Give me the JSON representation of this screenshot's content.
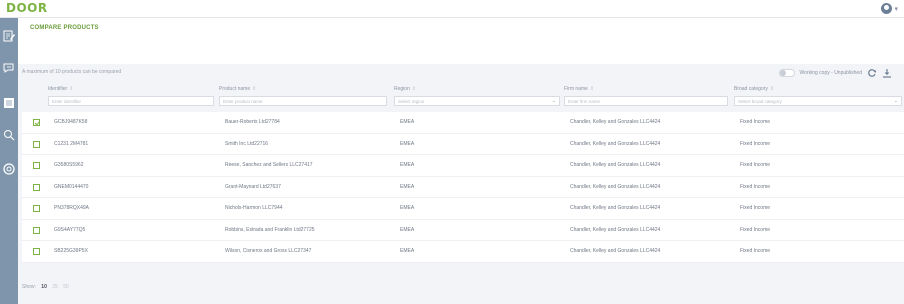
{
  "app": {
    "logo": "DOOR",
    "user_icon": "user-avatar-icon"
  },
  "sidebar": {
    "icons": [
      "edit-document-icon",
      "comment-edit-icon",
      "list-icon",
      "search-settings-icon",
      "support-lifebuoy-icon"
    ]
  },
  "page": {
    "title": "COMPARE PRODUCTS",
    "info": "A maximum of 10 products can be compared",
    "working_copy_label": "Working copy - Unpublished"
  },
  "table": {
    "columns": [
      {
        "label": "Identifier",
        "placeholder": "Enter identifier",
        "select": false
      },
      {
        "label": "Product name",
        "placeholder": "Enter product name",
        "select": false
      },
      {
        "label": "Region",
        "placeholder": "Select region",
        "select": true
      },
      {
        "label": "Firm name",
        "placeholder": "Enter firm name",
        "select": false
      },
      {
        "label": "Broad category",
        "placeholder": "Select broad category",
        "select": true
      }
    ],
    "rows": [
      {
        "checked": true,
        "cells": [
          "GCBJ9487K58",
          "Bauer-Roberts Ltd27784",
          "EMEA",
          "Chandler, Kelley and Gonzales LLC4424",
          "Fixed Income"
        ]
      },
      {
        "checked": false,
        "cells": [
          "C1231 2M4781",
          "Smith Inc Ltd22716",
          "EMEA",
          "Chandler, Kelley and Gonzales LLC4424",
          "Fixed Income"
        ]
      },
      {
        "checked": false,
        "cells": [
          "G3580S5962",
          "Reese, Sanchez and Sellers LLC27417",
          "EMEA",
          "Chandler, Kelley and Gonzales LLC4424",
          "Fixed Income"
        ]
      },
      {
        "checked": false,
        "cells": [
          "GNEM0144470",
          "Grant-Maynard Ltd27637",
          "EMEA",
          "Chandler, Kelley and Gonzales LLC4424",
          "Fixed Income"
        ]
      },
      {
        "checked": false,
        "cells": [
          "PN378RQX49A",
          "Nichols-Harmon LLC7944",
          "EMEA",
          "Chandler, Kelley and Gonzales LLC4424",
          "Fixed Income"
        ]
      },
      {
        "checked": false,
        "cells": [
          "G9S4AY77Q5",
          "Robbins, Estrada and Franklin Ltd27725",
          "EMEA",
          "Chandler, Kelley and Gonzales LLC4424",
          "Fixed Income"
        ]
      },
      {
        "checked": false,
        "cells": [
          "SB225G39P5X",
          "Wilson, Cisneros and Gross LLC27347",
          "EMEA",
          "Chandler, Kelley and Gonzales LLC4424",
          "Fixed Income"
        ]
      }
    ]
  },
  "pager": {
    "label": "Show:",
    "options": [
      "10",
      "25",
      "50"
    ],
    "current": "10"
  },
  "colors": {
    "accent": "#7cb342",
    "sidebar": "#7f95ab",
    "background": "#f3f4f7"
  }
}
